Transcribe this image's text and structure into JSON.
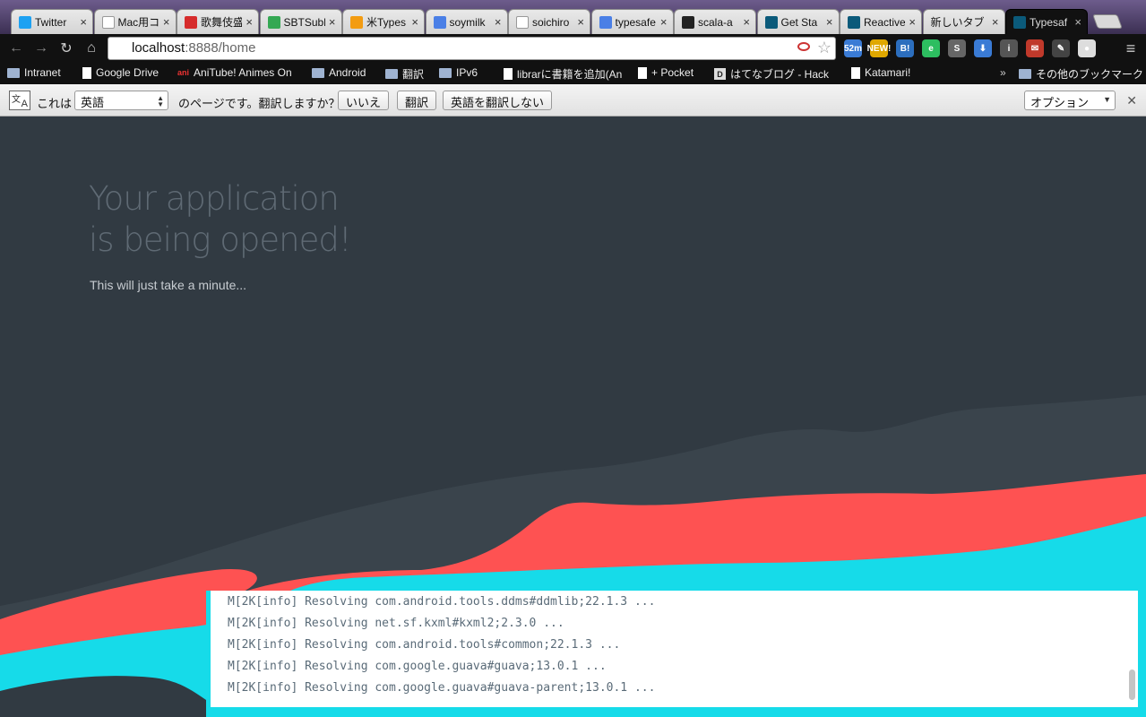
{
  "browser": {
    "tabs": [
      {
        "title": "Twitter",
        "favicon": "twitter-icon",
        "color": "#1da1f2"
      },
      {
        "title": "Mac用コ",
        "favicon": "page-icon",
        "color": "#ffffff"
      },
      {
        "title": "歌舞伎盛",
        "favicon": "ticket-icon",
        "color": "#d62b2b"
      },
      {
        "title": "SBTSubl",
        "favicon": "play-icon",
        "color": "#34a853"
      },
      {
        "title": "米Types",
        "favicon": "ball-icon",
        "color": "#f39c12"
      },
      {
        "title": "soymilk",
        "favicon": "google-icon",
        "color": "#4a7fe6"
      },
      {
        "title": "soichiro",
        "favicon": "page-icon",
        "color": "#ffffff"
      },
      {
        "title": "typesafe",
        "favicon": "google-icon",
        "color": "#4a7fe6"
      },
      {
        "title": "scala-a",
        "favicon": "github-icon",
        "color": "#222222"
      },
      {
        "title": "Get Sta",
        "favicon": "typesafe-icon",
        "color": "#0b5a7a"
      },
      {
        "title": "Reactive",
        "favicon": "typesafe-icon",
        "color": "#0b5a7a"
      },
      {
        "title": "新しいタブ",
        "favicon": "",
        "color": ""
      },
      {
        "title": "Typesaf",
        "favicon": "typesafe-icon",
        "color": "#0b5a7a",
        "active": true
      }
    ],
    "url_host": "localhost",
    "url_path": ":8888/home",
    "extensions": [
      {
        "name": "mail-badge-icon",
        "label": "52m",
        "color": "#3a7bd5"
      },
      {
        "name": "new-badge-icon",
        "label": "NEW!",
        "color": "#e0a800"
      },
      {
        "name": "hatena-bookmark-icon",
        "label": "B!",
        "color": "#2c6ebe"
      },
      {
        "name": "evernote-clip-icon",
        "label": "e",
        "color": "#2dbe60"
      },
      {
        "name": "s-icon",
        "label": "S",
        "color": "#666666"
      },
      {
        "name": "download-icon",
        "label": "⬇",
        "color": "#3a7bd5"
      },
      {
        "name": "info-icon",
        "label": "i",
        "color": "#555555"
      },
      {
        "name": "inbox-icon",
        "label": "✉",
        "color": "#c0392b"
      },
      {
        "name": "elephant-icon",
        "label": "✎",
        "color": "#444444"
      },
      {
        "name": "profile-icon",
        "label": "●",
        "color": "#dddddd"
      }
    ],
    "bookmarks": [
      {
        "label": "Intranet",
        "type": "folder"
      },
      {
        "label": "Google Drive",
        "type": "gd"
      },
      {
        "label": "AniTube! Animes On",
        "type": "ani"
      },
      {
        "label": "Android",
        "type": "folder"
      },
      {
        "label": "翻訳",
        "type": "folder"
      },
      {
        "label": "IPv6",
        "type": "folder"
      },
      {
        "label": "librarに書籍を追加(An",
        "type": "page"
      },
      {
        "label": "+ Pocket",
        "type": "page"
      },
      {
        "label": "はてなブログ - Hack",
        "type": "dd"
      },
      {
        "label": "Katamari!",
        "type": "page"
      }
    ],
    "bookmarks_more": "»",
    "other_bookmarks": "その他のブックマーク"
  },
  "translate_bar": {
    "prefix": "これは",
    "language": "英語",
    "suffix": "のページです。翻訳しますか？",
    "no_label": "いいえ",
    "translate_label": "翻訳",
    "never_label": "英語を翻訳しない",
    "options_label": "オプション"
  },
  "page": {
    "headline_line1": "Your application",
    "headline_line2": "is being opened!",
    "subline": "This will just take a minute...",
    "log_lines": [
      "M[2K[info] Resolving com.android.tools.ddms#ddmlib;22.1.3 ...",
      "M[2K[info] Resolving net.sf.kxml#kxml2;2.3.0 ...",
      "M[2K[info] Resolving com.android.tools#common;22.1.3 ...",
      "M[2K[info] Resolving com.google.guava#guava;13.0.1 ...",
      "M[2K[info] Resolving com.google.guava#guava-parent;13.0.1 ..."
    ]
  },
  "colors": {
    "background": "#313a42",
    "wave_dark": "#3a444c",
    "wave_red": "#fe5252",
    "wave_cyan": "#16dbe9"
  }
}
